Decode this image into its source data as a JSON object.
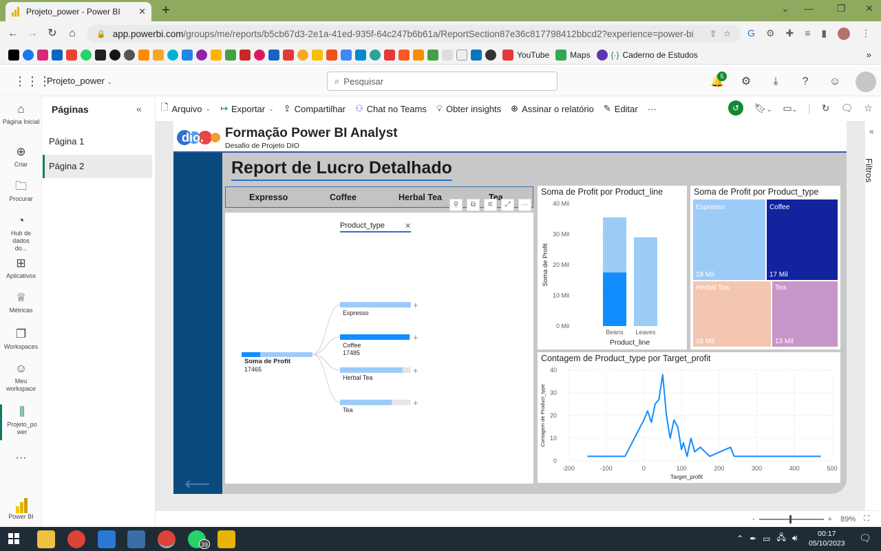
{
  "browser": {
    "tab_title": "Projeto_power - Power BI",
    "url_domain": "app.powerbi.com",
    "url_path": "/groups/me/reports/b5cb67d3-2e1a-41ed-935f-64c247b6b61a/ReportSection87e36c817798412bbcd2?experience=power-bi",
    "bookmarks_text": [
      "YouTube",
      "Maps",
      "Caderno de Estudos"
    ]
  },
  "pbi_header": {
    "workspace": "Projeto_power",
    "search_placeholder": "Pesquisar",
    "notif_count": "5"
  },
  "leftnav": [
    {
      "label": "Página Inicial",
      "icon": "home-icon"
    },
    {
      "label": "Criar",
      "icon": "plus-circle-icon"
    },
    {
      "label": "Procurar",
      "icon": "folder-icon"
    },
    {
      "label": "Hub de dados do...",
      "icon": "data-hub-icon"
    },
    {
      "label": "Aplicativos",
      "icon": "apps-icon"
    },
    {
      "label": "Métricas",
      "icon": "trophy-icon"
    },
    {
      "label": "Workspaces",
      "icon": "workspaces-icon"
    },
    {
      "label": "Meu workspace",
      "icon": "user-icon"
    },
    {
      "label": "Projeto_po wer",
      "icon": "report-icon"
    },
    {
      "label": "Power BI",
      "icon": "powerbi-logo"
    }
  ],
  "pages_pane": {
    "title": "Páginas",
    "pages": [
      "Página 1",
      "Página 2"
    ],
    "active": "Página 2"
  },
  "toolbar": {
    "arquivo": "Arquivo",
    "exportar": "Exportar",
    "compartilhar": "Compartilhar",
    "chat_teams": "Chat no Teams",
    "insights": "Obter insights",
    "assinar": "Assinar o relatório",
    "editar": "Editar"
  },
  "report": {
    "header_title": "Formação Power BI Analyst",
    "header_subtitle": "Desafio de Projeto DIO",
    "page_title": "Report de Lucro Detalhado",
    "slicer_items": [
      "Expresso",
      "Coffee",
      "Herbal Tea",
      "Tea"
    ]
  },
  "decomp_tree": {
    "level_header": "Product_type",
    "root_label": "Soma de Profit",
    "root_value": "17465",
    "nodes": [
      {
        "label": "Espresso",
        "value": "",
        "fill": 1.0,
        "selected": false
      },
      {
        "label": "Coffee",
        "value": "17485",
        "fill": 0.98,
        "selected": true
      },
      {
        "label": "Herbal Tea",
        "value": "",
        "fill": 0.88,
        "selected": false
      },
      {
        "label": "Tea",
        "value": "",
        "fill": 0.73,
        "selected": false
      }
    ]
  },
  "filters_label": "Filtros",
  "zoom": "89%",
  "clock": {
    "time": "00:17",
    "date": "05/10/2023"
  },
  "taskbar_badge": "39",
  "chart_data": [
    {
      "type": "bar",
      "title": "Soma de Profit por Product_line",
      "xlabel": "Product_line",
      "ylabel": "Soma de Profit",
      "categories": [
        "Beans",
        "Leaves"
      ],
      "series": [
        {
          "values": [
            17.5,
            29
          ],
          "color": "#118dff"
        },
        {
          "values": [
            35.5,
            29
          ],
          "color": "#9dcbf7"
        }
      ],
      "highlight_note": "Beans bar shows highlighted portion ~17.5 of total ~35.5",
      "yticks": [
        "0 Mil",
        "10 Mil",
        "20 Mil",
        "30 Mil",
        "40 Mil"
      ],
      "ylim": [
        0,
        40
      ]
    },
    {
      "type": "treemap",
      "title": "Soma de Profit por Product_type",
      "items": [
        {
          "label": "Espresso",
          "value": "18 Mil",
          "color": "#9dcbf7"
        },
        {
          "label": "Coffee",
          "value": "17 Mil",
          "color": "#12239e"
        },
        {
          "label": "Herbal Tea",
          "value": "16 Mil",
          "color": "#f3c6b1"
        },
        {
          "label": "Tea",
          "value": "13 Mil",
          "color": "#c796c8"
        }
      ]
    },
    {
      "type": "line",
      "title": "Contagem de Product_type por Target_profit",
      "xlabel": "Target_profit",
      "ylabel": "Contagem de Product_type",
      "xlim": [
        -200,
        500
      ],
      "ylim": [
        0,
        40
      ],
      "xticks": [
        -200,
        -100,
        0,
        100,
        200,
        300,
        400,
        500
      ],
      "yticks": [
        0,
        10,
        20,
        30,
        40
      ],
      "color": "#118dff",
      "points": [
        [
          -150,
          2
        ],
        [
          -50,
          2
        ],
        [
          0,
          18
        ],
        [
          10,
          22
        ],
        [
          20,
          17
        ],
        [
          30,
          25
        ],
        [
          40,
          27
        ],
        [
          50,
          38
        ],
        [
          60,
          20
        ],
        [
          70,
          10
        ],
        [
          80,
          18
        ],
        [
          90,
          15
        ],
        [
          100,
          5
        ],
        [
          105,
          8
        ],
        [
          115,
          2
        ],
        [
          125,
          10
        ],
        [
          135,
          4
        ],
        [
          150,
          6
        ],
        [
          175,
          2
        ],
        [
          230,
          6
        ],
        [
          240,
          2
        ],
        [
          470,
          2
        ]
      ]
    }
  ]
}
